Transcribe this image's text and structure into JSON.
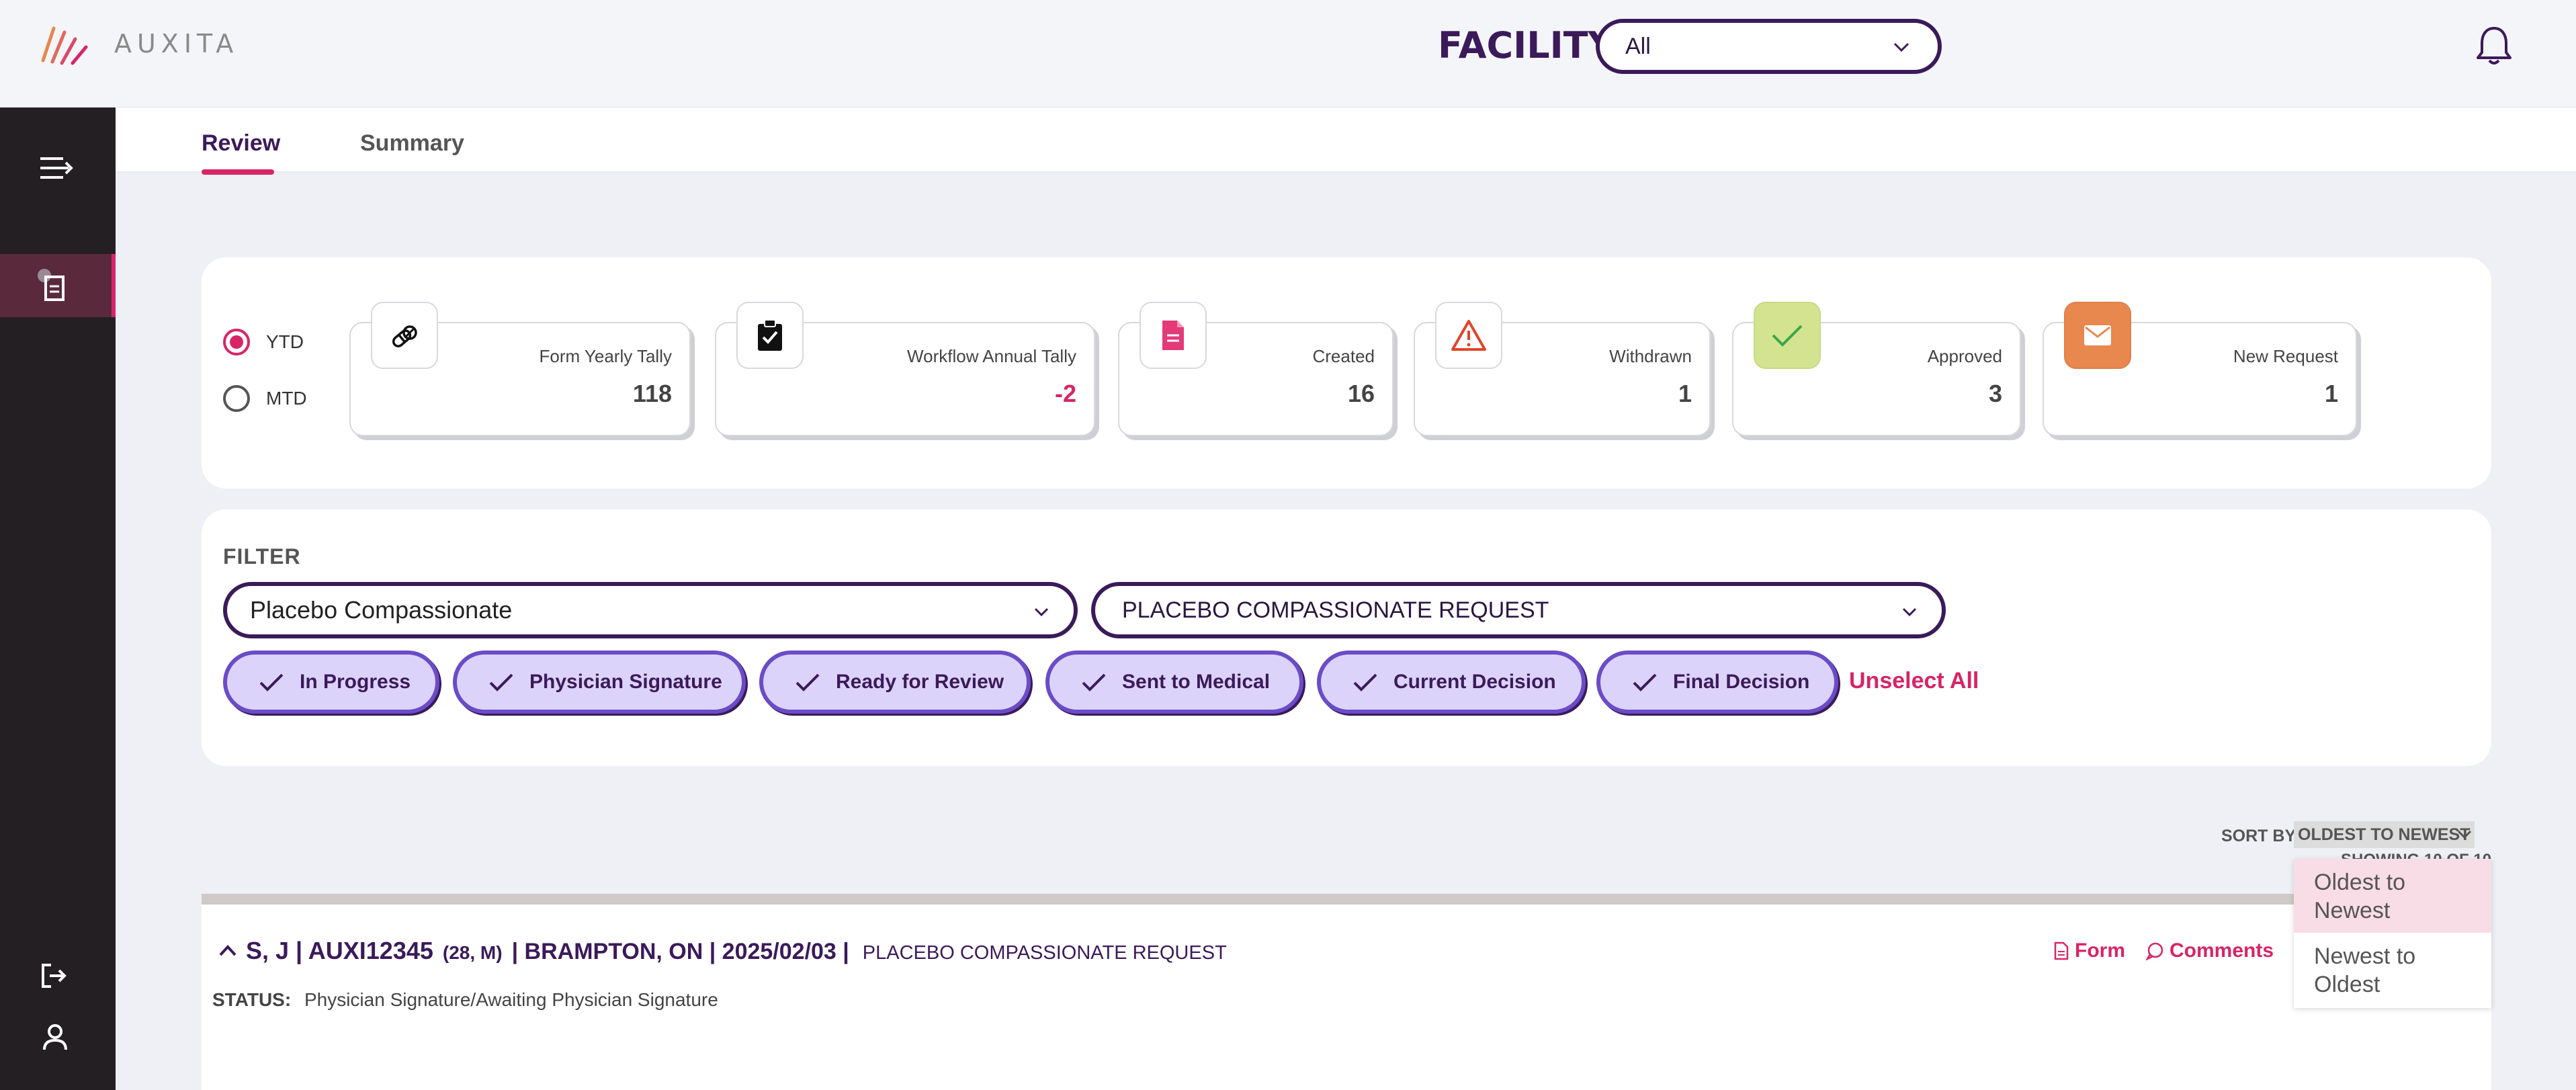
{
  "header": {
    "logo_text": "AUXITA",
    "facility_label": "FACILITY",
    "facility_value": "All"
  },
  "tabs": [
    {
      "label": "Review",
      "active": true
    },
    {
      "label": "Summary",
      "active": false
    }
  ],
  "period": {
    "options": [
      "YTD",
      "MTD"
    ],
    "selected": "YTD"
  },
  "stats": [
    {
      "label": "Form Yearly Tally",
      "value": "118",
      "icon": "pills-icon"
    },
    {
      "label": "Workflow Annual Tally",
      "value": "-2",
      "icon": "clipboard-check-icon"
    },
    {
      "label": "Created",
      "value": "16",
      "icon": "document-icon"
    },
    {
      "label": "Withdrawn",
      "value": "1",
      "icon": "warning-icon"
    },
    {
      "label": "Approved",
      "value": "3",
      "icon": "check-icon"
    },
    {
      "label": "New Request",
      "value": "1",
      "icon": "envelope-icon"
    }
  ],
  "filter": {
    "title": "FILTER",
    "program": "Placebo Compassionate",
    "request_type": "PLACEBO COMPASSIONATE REQUEST",
    "chips": [
      "In Progress",
      "Physician Signature",
      "Ready for Review",
      "Sent to Medical",
      "Current Decision",
      "Final Decision"
    ],
    "unselect_all": "Unselect All"
  },
  "sort": {
    "label": "SORT BY",
    "value": "OLDEST TO NEWEST",
    "showing": "SHOWING 10 OF 10",
    "options": [
      "Oldest to Newest",
      "Newest to Oldest"
    ]
  },
  "record": {
    "title": "S, J | AUXI12345",
    "age_sex": "(28, M)",
    "location_date": "| BRAMPTON, ON | 2025/02/03 |",
    "request_type": "PLACEBO COMPASSIONATE REQUEST",
    "status_label": "STATUS:",
    "status_value": "Physician Signature/Awaiting Physician Signature",
    "links": {
      "form": "Form",
      "comments": "Comments"
    }
  },
  "colors": {
    "primary": "#3b1a5a",
    "accent": "#d82466",
    "chip_fill": "#dcd3fb",
    "approved_badge": "#d4e38f",
    "new_request_badge": "#e8874e"
  }
}
